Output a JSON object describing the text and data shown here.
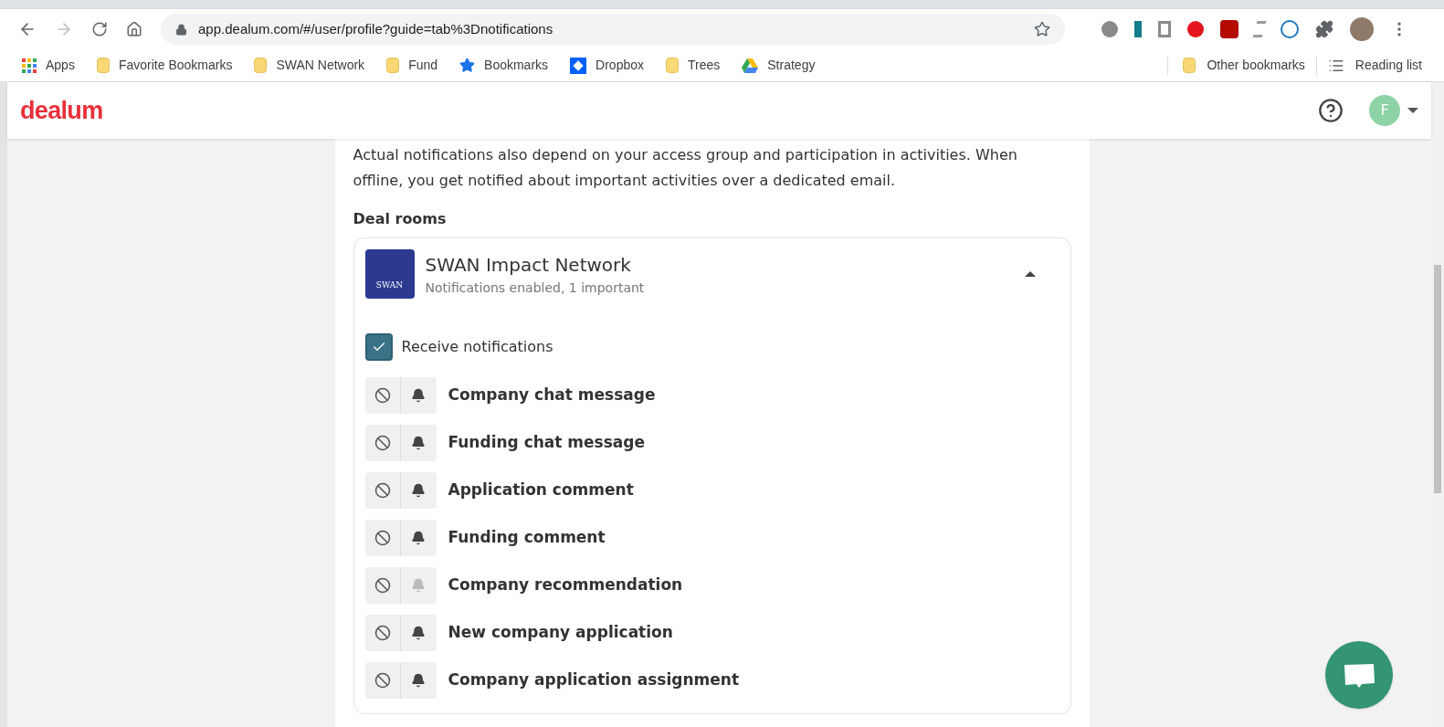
{
  "browser": {
    "url": "app.dealum.com/#/user/profile?guide=tab%3Dnotifications",
    "bookmarks": [
      {
        "label": "Apps",
        "kind": "apps"
      },
      {
        "label": "Favorite Bookmarks",
        "kind": "folder"
      },
      {
        "label": "SWAN Network",
        "kind": "folder"
      },
      {
        "label": "Fund",
        "kind": "folder"
      },
      {
        "label": "Bookmarks",
        "kind": "star"
      },
      {
        "label": "Dropbox",
        "kind": "dropbox"
      },
      {
        "label": "Trees",
        "kind": "folder"
      },
      {
        "label": "Strategy",
        "kind": "drive"
      }
    ],
    "other_bookmarks": "Other bookmarks",
    "reading_list": "Reading list"
  },
  "header": {
    "logo": "dealum",
    "avatar_initial": "F"
  },
  "intro": "Actual notifications also depend on your access group and participation in activities. When offline, you get notified about important activities over a dedicated email.",
  "section_title": "Deal rooms",
  "deal_room": {
    "name": "SWAN Impact Network",
    "logo_text": "SWAN",
    "status": "Notifications enabled, 1 important",
    "expanded": true,
    "receive": {
      "label": "Receive notifications",
      "checked": true
    },
    "items": [
      {
        "label": "Company chat message",
        "important": true
      },
      {
        "label": "Funding chat message",
        "important": true
      },
      {
        "label": "Application comment",
        "important": true
      },
      {
        "label": "Funding comment",
        "important": true
      },
      {
        "label": "Company recommendation",
        "important": false
      },
      {
        "label": "New company application",
        "important": true
      },
      {
        "label": "Company application assignment",
        "important": true
      }
    ]
  }
}
